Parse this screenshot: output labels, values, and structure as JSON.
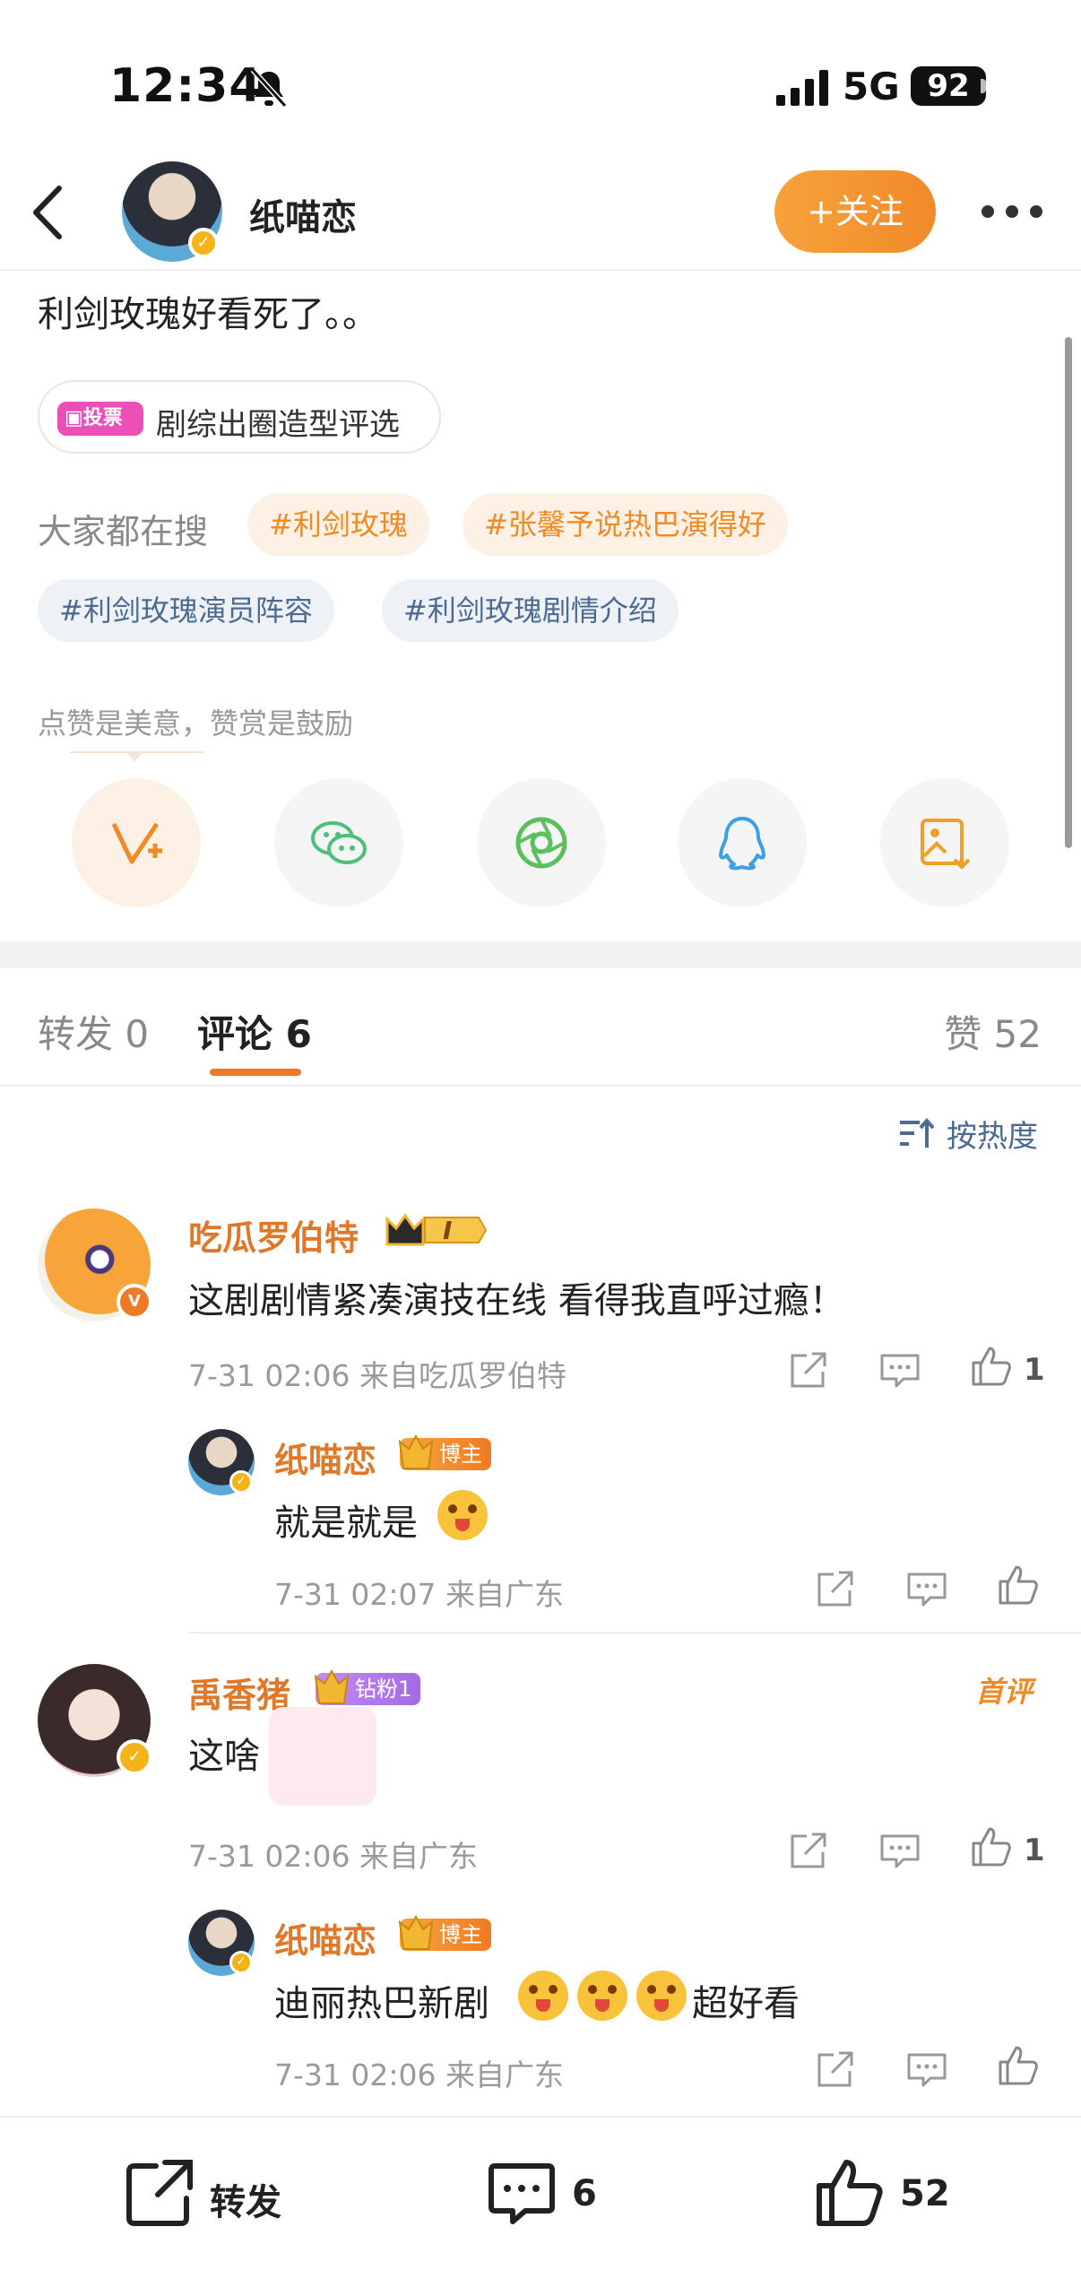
{
  "status_bar": {
    "time": "12:34",
    "network": "5G",
    "battery": "92"
  },
  "header": {
    "username": "纸喵恋",
    "follow_label": "+关注"
  },
  "post": {
    "text": "利剑玫瑰好看死了。。",
    "vote_tag": "投票",
    "vote_title": "剧综出圈造型评选",
    "search_label": "大家都在搜",
    "search_tags": [
      "#利剑玫瑰",
      "#张馨予说热巴演得好",
      "#利剑玫瑰演员阵容",
      "#利剑玫瑰剧情介绍"
    ],
    "appreciate_text": "点赞是美意，赞赏是鼓励"
  },
  "tabs": {
    "repost": "转发 0",
    "comment": "评论 6",
    "like": "赞 52"
  },
  "sort_label": "按热度",
  "comments": [
    {
      "name": "吃瓜罗伯特",
      "level_badge": "I",
      "text": "这剧剧情紧凑演技在线 看得我直呼过瘾！",
      "meta": "7-31 02:06 来自吃瓜罗伯特",
      "likes": "1",
      "reply": {
        "name": "纸喵恋",
        "badge": "博主",
        "text": "就是就是",
        "meta": "7-31 02:07 来自广东"
      }
    },
    {
      "name": "禹香猪",
      "badge": "钻粉1",
      "first_tag": "首评",
      "text": "这啥",
      "meta": "7-31 02:06 来自广东",
      "likes": "1",
      "reply": {
        "name": "纸喵恋",
        "badge": "博主",
        "text_a": "迪丽热巴新剧",
        "text_b": "超好看",
        "meta": "7-31 02:06 来自广东"
      }
    }
  ],
  "bottom_bar": {
    "repost": "转发",
    "comment_count": "6",
    "like_count": "52"
  },
  "colors": {
    "accent": "#f08a24",
    "link_blue": "#4b6b93",
    "name_orange": "#e0782a"
  },
  "icons": [
    "bell-slash-icon",
    "signal-icon",
    "back-arrow-icon",
    "more-icon",
    "vote-icon",
    "appreciate-icon",
    "wechat-icon",
    "moments-icon",
    "qq-icon",
    "save-image-icon",
    "sort-icon",
    "share-icon",
    "comment-icon",
    "like-icon"
  ]
}
